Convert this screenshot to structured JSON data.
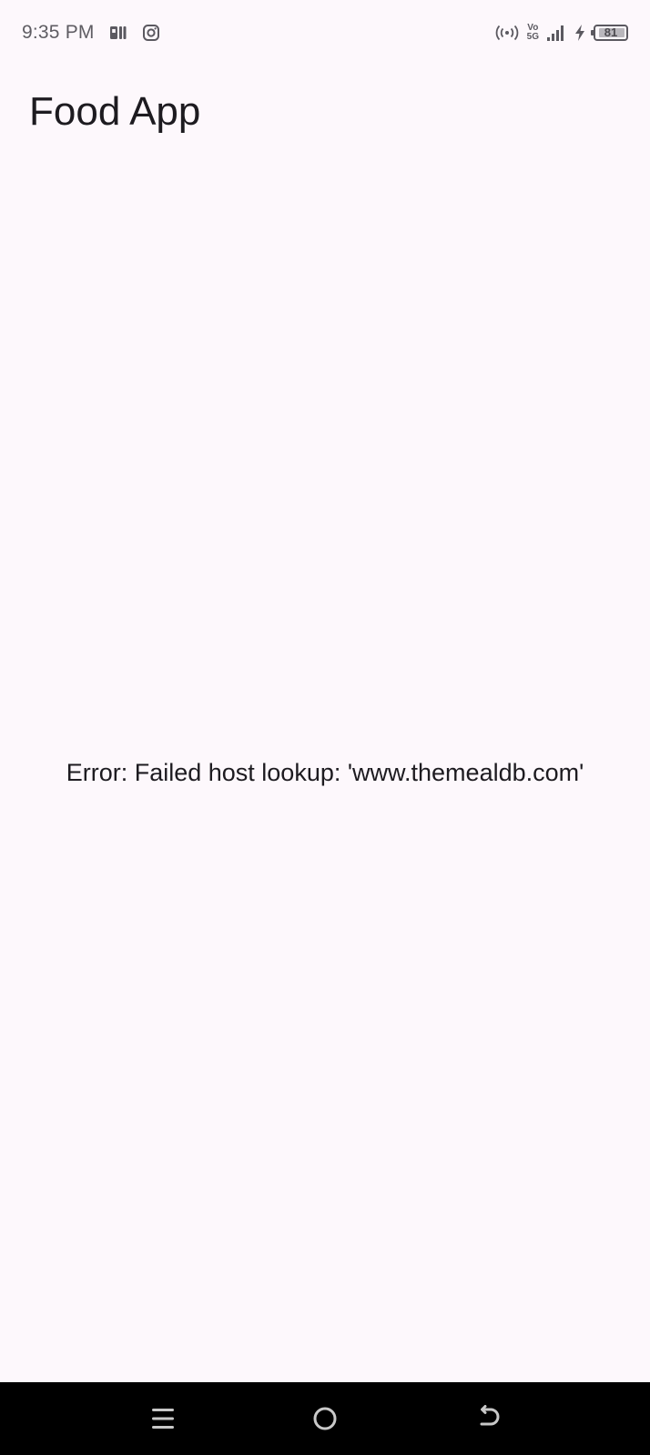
{
  "status_bar": {
    "time": "9:35 PM",
    "left_icons": [
      "paytm-notification-icon",
      "instagram-icon"
    ],
    "right_icons": [
      "hotspot-icon",
      "volte-5g-icon",
      "signal-icon",
      "charging-icon",
      "battery-icon"
    ],
    "volte_top": "Vo",
    "volte_bottom": "5G",
    "battery_level": "81"
  },
  "app_bar": {
    "title": "Food App"
  },
  "content": {
    "error_message": "Error: Failed host lookup: 'www.themealdb.com'"
  },
  "nav_bar": {
    "buttons": [
      "menu-icon",
      "home-icon",
      "back-icon"
    ]
  },
  "colors": {
    "background": "#fdf8fc",
    "text": "#1d1b20",
    "nav_bar": "#000000"
  }
}
